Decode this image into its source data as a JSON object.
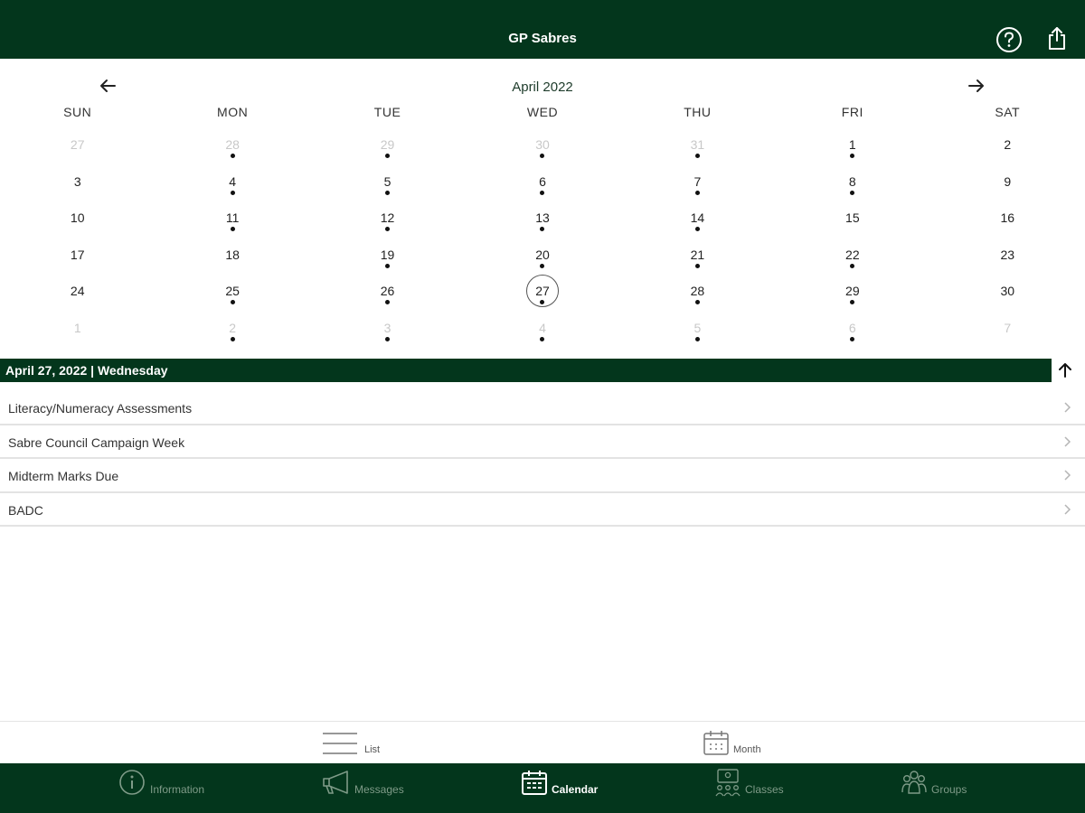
{
  "app": {
    "title": "GP Sabres"
  },
  "header": {
    "help_icon": "help-circle-icon",
    "share_icon": "share-icon"
  },
  "calendar": {
    "month_label": "April 2022",
    "weekdays": [
      "SUN",
      "MON",
      "TUE",
      "WED",
      "THU",
      "FRI",
      "SAT"
    ],
    "weeks": [
      [
        {
          "n": "27",
          "out": true,
          "dot": false
        },
        {
          "n": "28",
          "out": true,
          "dot": true
        },
        {
          "n": "29",
          "out": true,
          "dot": true
        },
        {
          "n": "30",
          "out": true,
          "dot": true
        },
        {
          "n": "31",
          "out": true,
          "dot": true
        },
        {
          "n": "1",
          "out": false,
          "dot": true
        },
        {
          "n": "2",
          "out": false,
          "dot": false
        }
      ],
      [
        {
          "n": "3",
          "out": false,
          "dot": false
        },
        {
          "n": "4",
          "out": false,
          "dot": true
        },
        {
          "n": "5",
          "out": false,
          "dot": true
        },
        {
          "n": "6",
          "out": false,
          "dot": true
        },
        {
          "n": "7",
          "out": false,
          "dot": true
        },
        {
          "n": "8",
          "out": false,
          "dot": true
        },
        {
          "n": "9",
          "out": false,
          "dot": false
        }
      ],
      [
        {
          "n": "10",
          "out": false,
          "dot": false
        },
        {
          "n": "11",
          "out": false,
          "dot": true
        },
        {
          "n": "12",
          "out": false,
          "dot": true
        },
        {
          "n": "13",
          "out": false,
          "dot": true
        },
        {
          "n": "14",
          "out": false,
          "dot": true
        },
        {
          "n": "15",
          "out": false,
          "dot": false
        },
        {
          "n": "16",
          "out": false,
          "dot": false
        }
      ],
      [
        {
          "n": "17",
          "out": false,
          "dot": false
        },
        {
          "n": "18",
          "out": false,
          "dot": false
        },
        {
          "n": "19",
          "out": false,
          "dot": true
        },
        {
          "n": "20",
          "out": false,
          "dot": true
        },
        {
          "n": "21",
          "out": false,
          "dot": true
        },
        {
          "n": "22",
          "out": false,
          "dot": true
        },
        {
          "n": "23",
          "out": false,
          "dot": false
        }
      ],
      [
        {
          "n": "24",
          "out": false,
          "dot": false
        },
        {
          "n": "25",
          "out": false,
          "dot": true
        },
        {
          "n": "26",
          "out": false,
          "dot": true
        },
        {
          "n": "27",
          "out": false,
          "dot": true,
          "selected": true
        },
        {
          "n": "28",
          "out": false,
          "dot": true
        },
        {
          "n": "29",
          "out": false,
          "dot": true
        },
        {
          "n": "30",
          "out": false,
          "dot": false
        }
      ],
      [
        {
          "n": "1",
          "out": true,
          "dot": false
        },
        {
          "n": "2",
          "out": true,
          "dot": true
        },
        {
          "n": "3",
          "out": true,
          "dot": true
        },
        {
          "n": "4",
          "out": true,
          "dot": true
        },
        {
          "n": "5",
          "out": true,
          "dot": true
        },
        {
          "n": "6",
          "out": true,
          "dot": true
        },
        {
          "n": "7",
          "out": true,
          "dot": false
        }
      ]
    ]
  },
  "selected_date": {
    "label": "April 27, 2022 | Wednesday"
  },
  "events": [
    {
      "label": "Literacy/Numeracy Assessments"
    },
    {
      "label": "Sabre Council Campaign Week"
    },
    {
      "label": "Midterm Marks Due"
    },
    {
      "label": "BADC"
    }
  ],
  "view_toggle": {
    "list_label": "List",
    "month_label": "Month"
  },
  "tabs": {
    "information": "Information",
    "messages": "Messages",
    "calendar": "Calendar",
    "classes": "Classes",
    "groups": "Groups",
    "active": "calendar"
  },
  "colors": {
    "brand": "#03361c",
    "tab_inactive": "#7f9b88",
    "background": "#ffffff"
  }
}
